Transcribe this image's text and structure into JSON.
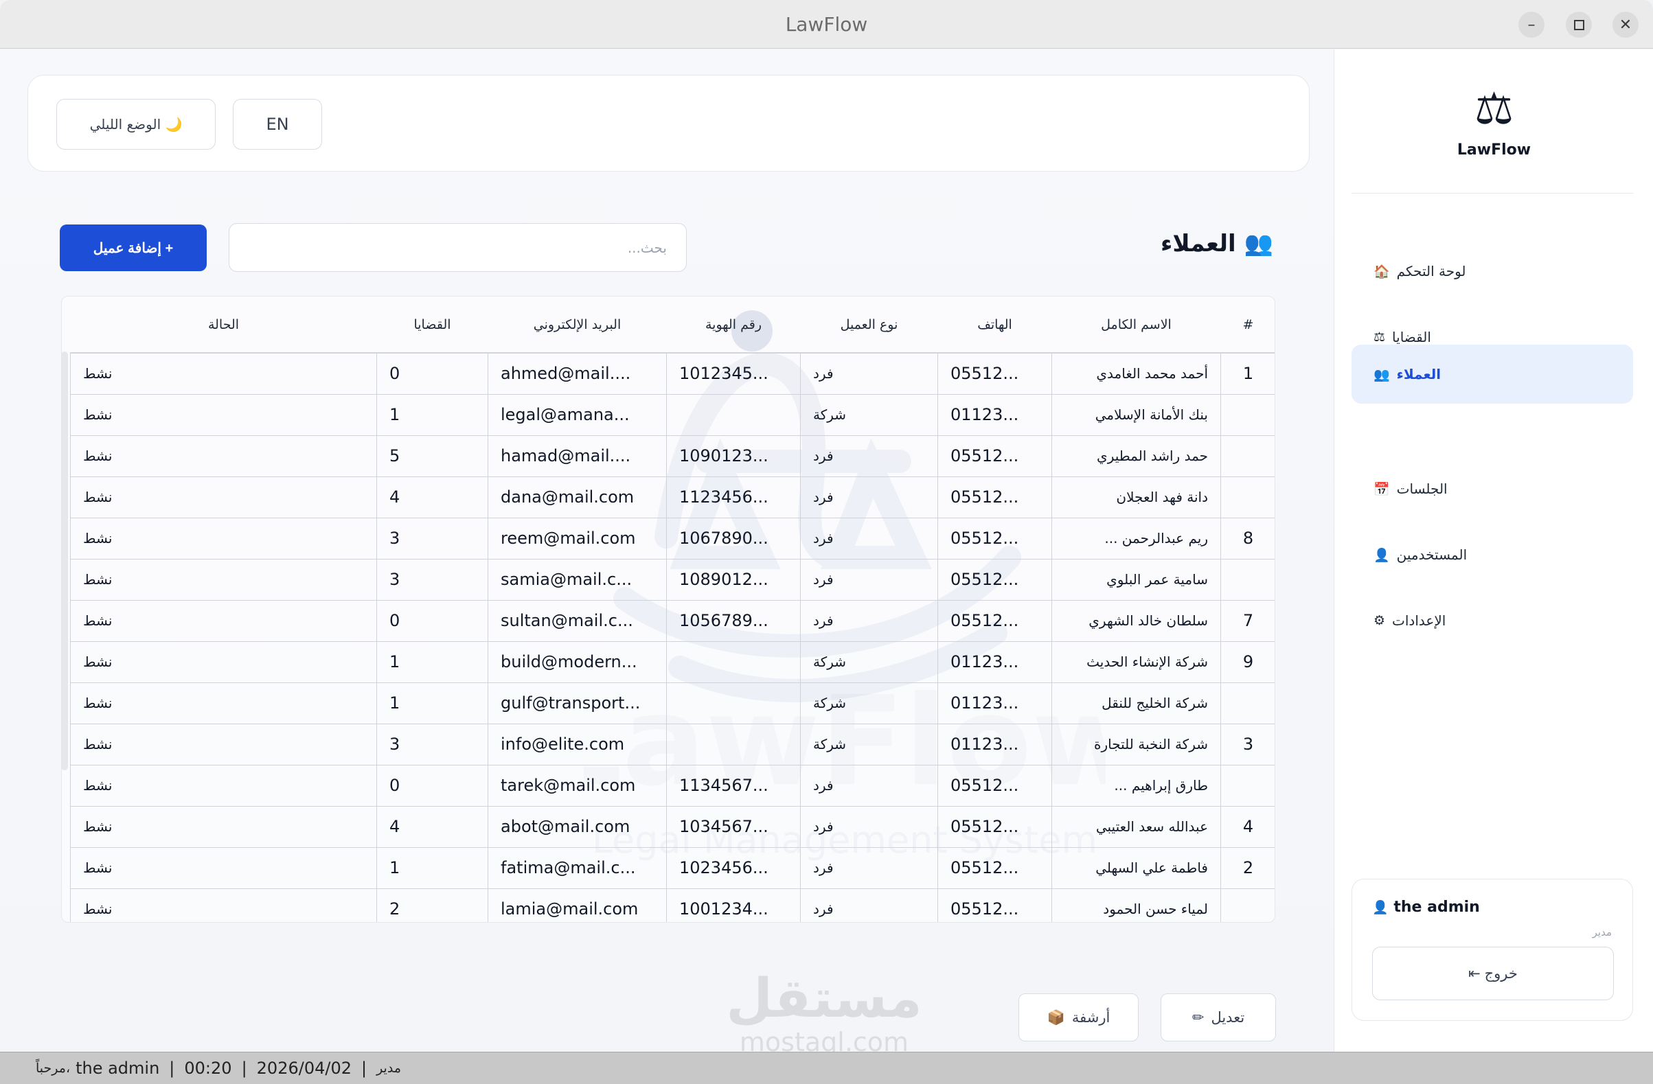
{
  "window": {
    "title": "LawFlow"
  },
  "topbar": {
    "dark_mode_label": "الوضع الليلي 🌙",
    "lang_label": "EN"
  },
  "page": {
    "title": "العملاء",
    "title_icon": "👥",
    "search_placeholder": "بحث...",
    "add_button": "إضافة عميل +"
  },
  "table": {
    "headers": {
      "index": "#",
      "name": "الاسم الكامل",
      "phone": "الهاتف",
      "type": "نوع العميل",
      "id": "رقم الهوية",
      "email": "البريد الإلكتروني",
      "cases": "القضايا",
      "status": "الحالة"
    },
    "rows": [
      {
        "index": "1",
        "name": "أحمد محمد الغامدي",
        "phone": "05512...",
        "type": "فرد",
        "id": "1012345...",
        "email": "ahmed@mail....",
        "cases": "0",
        "status": "نشط"
      },
      {
        "index": "",
        "name": "بنك الأمانة الإسلامي",
        "phone": "01123...",
        "type": "شركة",
        "id": "",
        "email": "legal@amana...",
        "cases": "1",
        "status": "نشط"
      },
      {
        "index": "",
        "name": "حمد راشد المطيري",
        "phone": "05512...",
        "type": "فرد",
        "id": "1090123...",
        "email": "hamad@mail....",
        "cases": "5",
        "status": "نشط"
      },
      {
        "index": "",
        "name": "دانة فهد العجلان",
        "phone": "05512...",
        "type": "فرد",
        "id": "1123456...",
        "email": "dana@mail.com",
        "cases": "4",
        "status": "نشط"
      },
      {
        "index": "8",
        "name": "ريم عبدالرحمن ...",
        "phone": "05512...",
        "type": "فرد",
        "id": "1067890...",
        "email": "reem@mail.com",
        "cases": "3",
        "status": "نشط"
      },
      {
        "index": "",
        "name": "سامية عمر البلوي",
        "phone": "05512...",
        "type": "فرد",
        "id": "1089012...",
        "email": "samia@mail.c...",
        "cases": "3",
        "status": "نشط"
      },
      {
        "index": "7",
        "name": "سلطان خالد الشهري",
        "phone": "05512...",
        "type": "فرد",
        "id": "1056789...",
        "email": "sultan@mail.c...",
        "cases": "0",
        "status": "نشط"
      },
      {
        "index": "9",
        "name": "شركة الإنشاء الحديث",
        "phone": "01123...",
        "type": "شركة",
        "id": "",
        "email": "build@modern...",
        "cases": "1",
        "status": "نشط"
      },
      {
        "index": "",
        "name": "شركة الخليج للنقل",
        "phone": "01123...",
        "type": "شركة",
        "id": "",
        "email": "gulf@transport...",
        "cases": "1",
        "status": "نشط"
      },
      {
        "index": "3",
        "name": "شركة النخبة للتجارة",
        "phone": "01123...",
        "type": "شركة",
        "id": "",
        "email": "info@elite.com",
        "cases": "3",
        "status": "نشط"
      },
      {
        "index": "",
        "name": "طارق إبراهيم ...",
        "phone": "05512...",
        "type": "فرد",
        "id": "1134567...",
        "email": "tarek@mail.com",
        "cases": "0",
        "status": "نشط"
      },
      {
        "index": "4",
        "name": "عبدالله سعد العتيبي",
        "phone": "05512...",
        "type": "فرد",
        "id": "1034567...",
        "email": "abot@mail.com",
        "cases": "4",
        "status": "نشط"
      },
      {
        "index": "2",
        "name": "فاطمة علي السهلي",
        "phone": "05512...",
        "type": "فرد",
        "id": "1023456...",
        "email": "fatima@mail.c...",
        "cases": "1",
        "status": "نشط"
      },
      {
        "index": "",
        "name": "لمياء حسن الحمود",
        "phone": "05512...",
        "type": "فرد",
        "id": "1001234...",
        "email": "lamia@mail.com",
        "cases": "2",
        "status": "نشط"
      }
    ]
  },
  "actions": {
    "edit_label": "تعديل",
    "edit_icon": "✏",
    "archive_label": "أرشفة",
    "archive_icon": "📦"
  },
  "watermark": {
    "brand": "LawFlow",
    "tagline": "Legal Management System",
    "site_ar": "مستقل",
    "site": "mostaql.com"
  },
  "sidebar": {
    "app_name": "LawFlow",
    "logo_icon": "⚖",
    "items": [
      {
        "label": "لوحة التحكم",
        "icon": "🏠"
      },
      {
        "label": "القضايا",
        "icon": "⚖"
      },
      {
        "label": "العملاء",
        "icon": "👥"
      },
      {
        "label": "الجلسات",
        "icon": "📅"
      },
      {
        "label": "المستخدمين",
        "icon": "👤"
      },
      {
        "label": "الإعدادات",
        "icon": "⚙"
      }
    ],
    "active_index": 2,
    "user": {
      "name": "the admin",
      "icon": "👤",
      "role": "مدير",
      "logout_label": "خروج ⇤"
    }
  },
  "statusbar": {
    "welcome": "مرحباً،",
    "user": "the admin",
    "time": "00:20",
    "date": "2026/04/02",
    "role": "مدير",
    "sep": "|"
  },
  "colors": {
    "accent": "#1d4ed8",
    "active_bg": "#e8effd",
    "titlebar": "#ebebeb",
    "statusbar": "#c8c8c8"
  }
}
